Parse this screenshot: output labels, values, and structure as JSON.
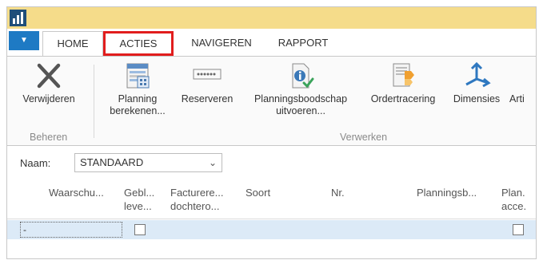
{
  "titlebar": {
    "app_icon": "dynamics-nav-icon"
  },
  "ribbon_tabs": {
    "app_menu_icon": "triangle-down-icon",
    "home": "HOME",
    "acties": "ACTIES",
    "navigeren": "NAVIGEREN",
    "rapport": "RAPPORT"
  },
  "ribbon": {
    "verwijderen": {
      "label": "Verwijderen",
      "icon": "delete-x-icon"
    },
    "planning": {
      "label1": "Planning",
      "label2": "berekenen...",
      "icon": "calculate-plan-icon"
    },
    "reserveren": {
      "label": "Reserveren",
      "icon": "reserve-icon"
    },
    "planningsboodschap": {
      "label1": "Planningsboodschap",
      "label2": "uitvoeren...",
      "icon": "carry-out-message-icon"
    },
    "ordertracering": {
      "label": "Ordertracering",
      "icon": "order-tracking-icon"
    },
    "dimensies": {
      "label": "Dimensies",
      "icon": "dimensions-icon"
    },
    "arti": {
      "label": "Arti"
    },
    "group_beheren": "Beheren",
    "group_verwerken": "Verwerken"
  },
  "filter": {
    "label": "Naam:",
    "value": "STANDAARD",
    "chevron": "⌄"
  },
  "grid": {
    "columns": [
      {
        "l1": "Waarschu...",
        "l2": ""
      },
      {
        "l1": "Gebl...",
        "l2": "leve..."
      },
      {
        "l1": "Facturere...",
        "l2": "dochtero..."
      },
      {
        "l1": "Soort",
        "l2": ""
      },
      {
        "l1": "Nr.",
        "l2": ""
      },
      {
        "l1": "Planningsb...",
        "l2": ""
      },
      {
        "l1": "Plan.",
        "l2": "acce."
      }
    ],
    "row": {
      "first_cell": "-"
    }
  }
}
